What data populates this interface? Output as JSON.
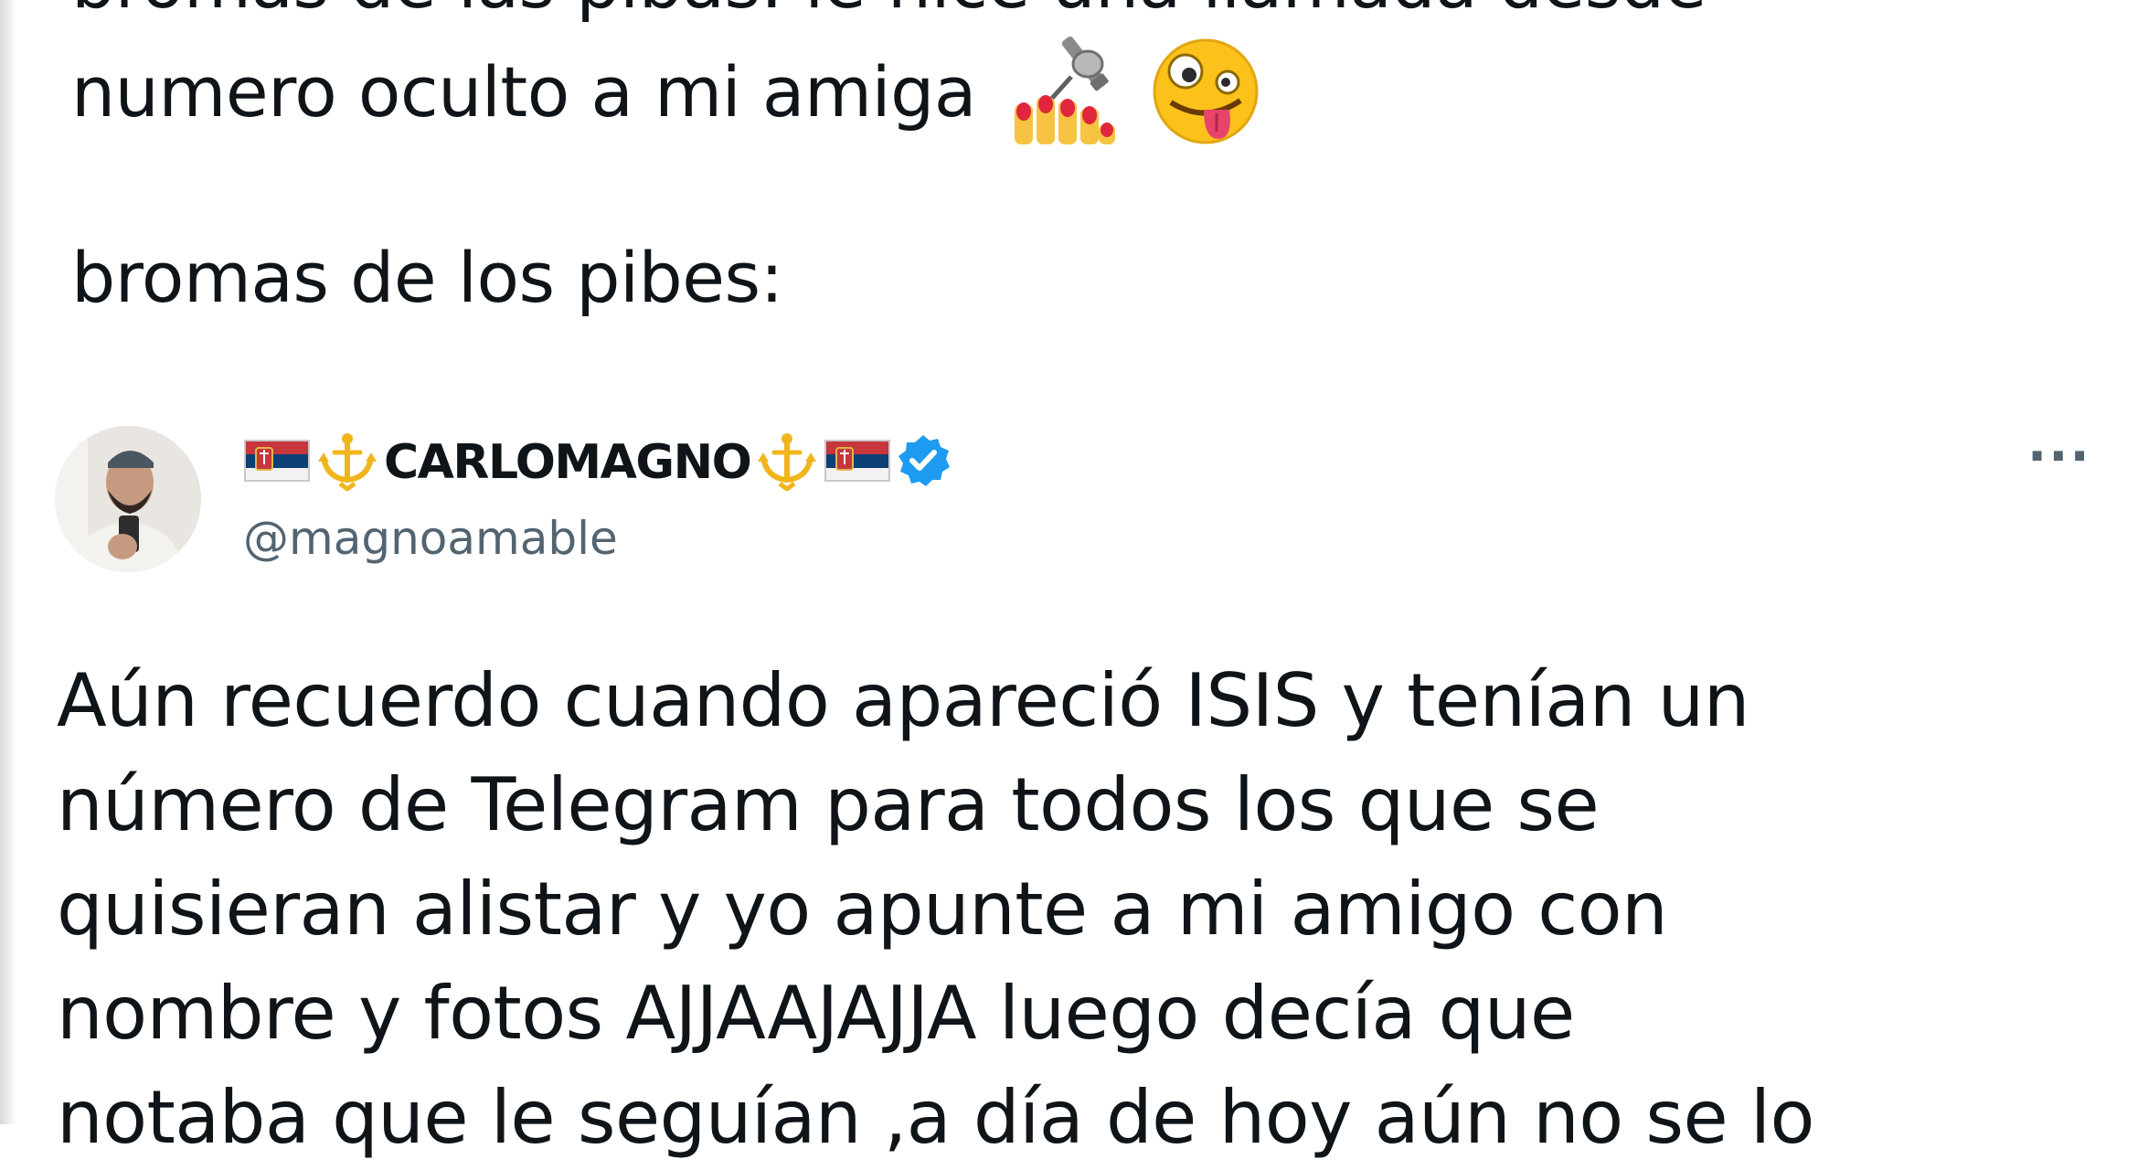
{
  "caption": {
    "line1": "bromas de las pibas: le hice una llamada desde",
    "line2": "numero oculto a mi amiga",
    "line3": "bromas de los pibes:"
  },
  "tweet": {
    "display_name": "CARLOMAGNO",
    "handle": "@magnoamable",
    "more_label": "···",
    "body_lines": [
      "Aún recuerdo cuando apareció ISIS y tenían un",
      "número de Telegram para todos los que se",
      "quisieran alistar y yo apunte a mi amigo con",
      "nombre y fotos  AJJAAJAJJA luego decía que",
      "notaba que le seguían ,a día de hoy aún no se lo"
    ]
  },
  "icons": [
    "nail-polish-emoji-icon",
    "zany-face-emoji-icon",
    "serbia-flag-icon",
    "trident-icon",
    "verified-badge-icon"
  ],
  "colors": {
    "text": "#0f1419",
    "secondary_text": "#536471",
    "verified_blue": "#1d9bf0"
  }
}
